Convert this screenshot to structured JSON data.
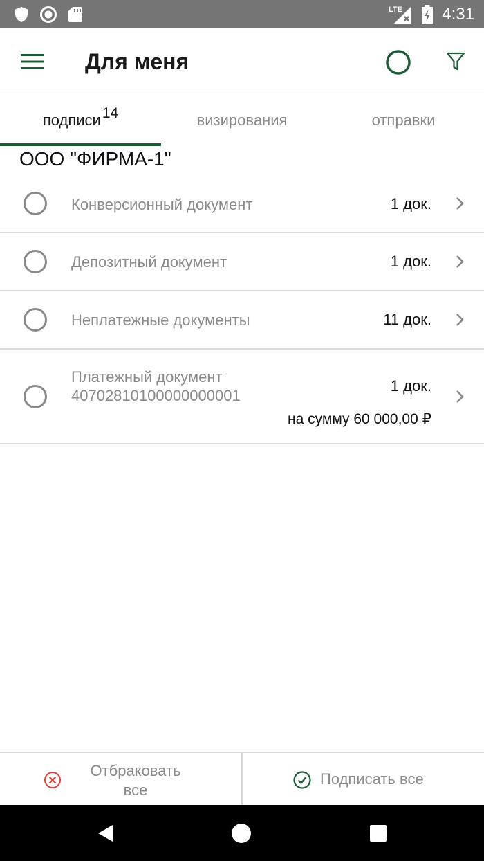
{
  "status_bar": {
    "time": "4:31",
    "network": "LTE",
    "icons": [
      "shield-icon",
      "circle-icon",
      "sd-card-icon",
      "signal-icon",
      "battery-icon"
    ]
  },
  "app_bar": {
    "title": "Для меня",
    "accent_color": "#1b5e36"
  },
  "tabs": [
    {
      "label": "подписи",
      "badge": "14",
      "selected": true
    },
    {
      "label": "визирования",
      "selected": false
    },
    {
      "label": "отправки",
      "selected": false
    }
  ],
  "organization": "ООО \"ФИРМА-1\"",
  "documents": [
    {
      "name": "Конверсионный документ",
      "count": "1 док."
    },
    {
      "name": "Депозитный документ",
      "count": "1 док."
    },
    {
      "name": "Неплатежные документы",
      "count": "11 док."
    },
    {
      "name": "Платежный документ",
      "account": "40702810100000000001",
      "count": "1 док.",
      "sum": "на сумму 60 000,00 ₽"
    }
  ],
  "actions": {
    "reject_line1": "Отбраковать",
    "reject_line2": "все",
    "sign_all": "Подписать все",
    "reject_color": "#e53935",
    "sign_color": "#1b5e36"
  }
}
